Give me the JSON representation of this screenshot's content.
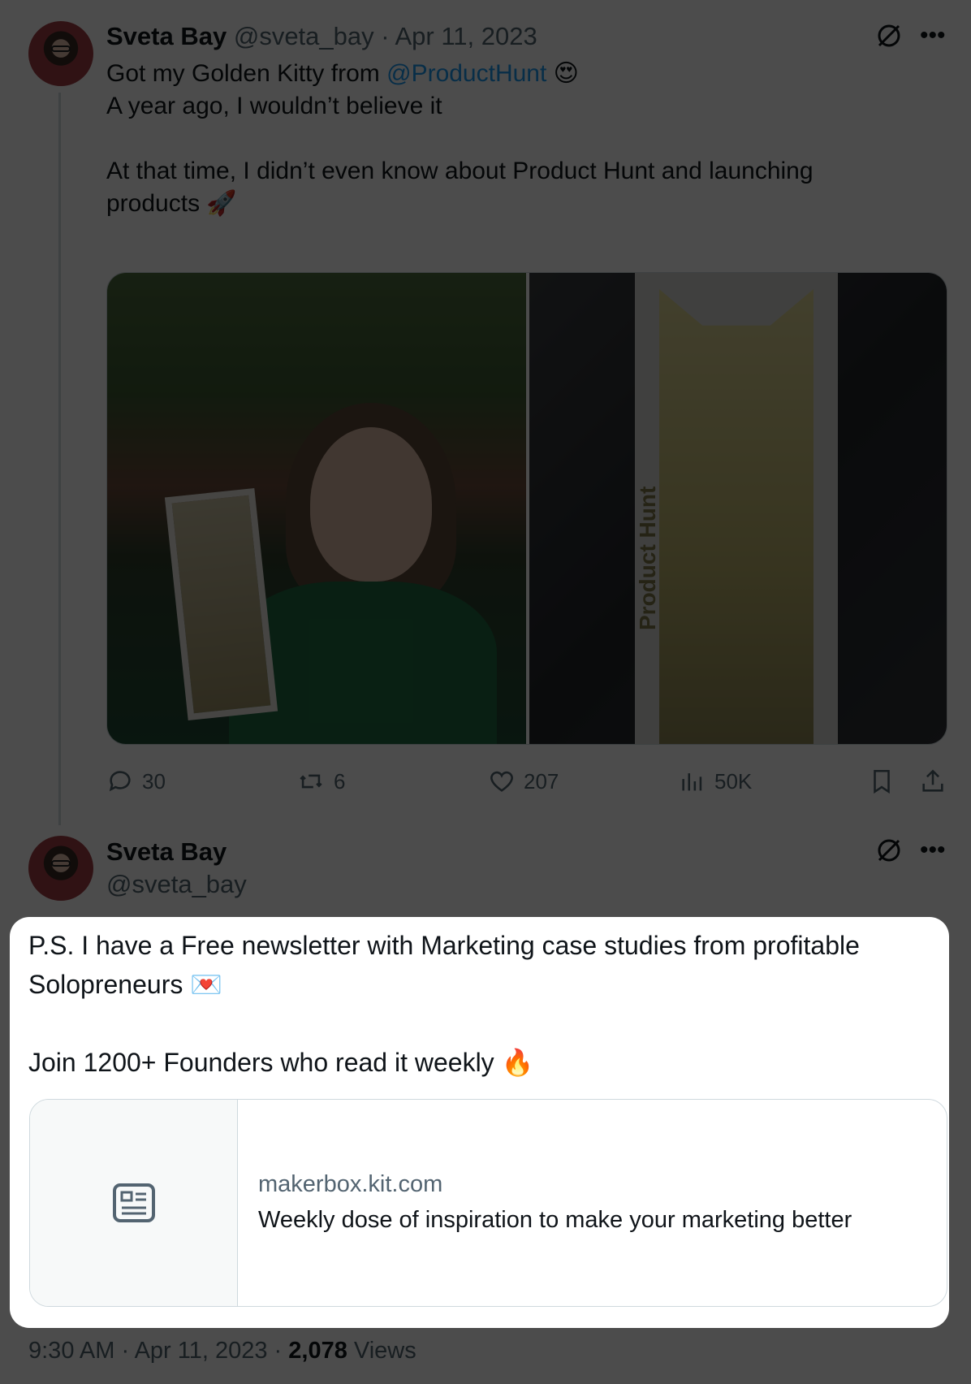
{
  "colors": {
    "link": "#1d9bf0",
    "muted": "#536471",
    "border": "#cfd9de",
    "text": "#0f1419"
  },
  "tweet1": {
    "name": "Sveta Bay",
    "meta": "@sveta_bay · Apr 11, 2023",
    "text_line1_prefix": "Got my Golden Kitty from ",
    "mention": "@ProductHunt",
    "text_line1_emoji": "😍",
    "text_body": "A year ago, I wouldn’t believe it\n\nAt that time, I didn’t even know about Product Hunt and launching\nproducts 🚀",
    "photo_label": "Product Hunt",
    "actions": {
      "replies": "30",
      "reposts": "6",
      "likes": "207",
      "views": "50K"
    }
  },
  "tweet2": {
    "name": "Sveta Bay",
    "handle": "@sveta_bay",
    "text": "P.S. I have a Free newsletter with Marketing case studies from profitable\nSolopreneurs 💌\n\nJoin 1200+ Founders who read it weekly 🔥",
    "card": {
      "domain": "makerbox.kit.com",
      "title": "Weekly dose of inspiration to make your marketing better",
      "icon": "article-icon"
    },
    "footer": {
      "time_date": "9:30 AM · Apr 11, 2023 · ",
      "views_count": "2,078",
      "views_label": " Views"
    }
  }
}
